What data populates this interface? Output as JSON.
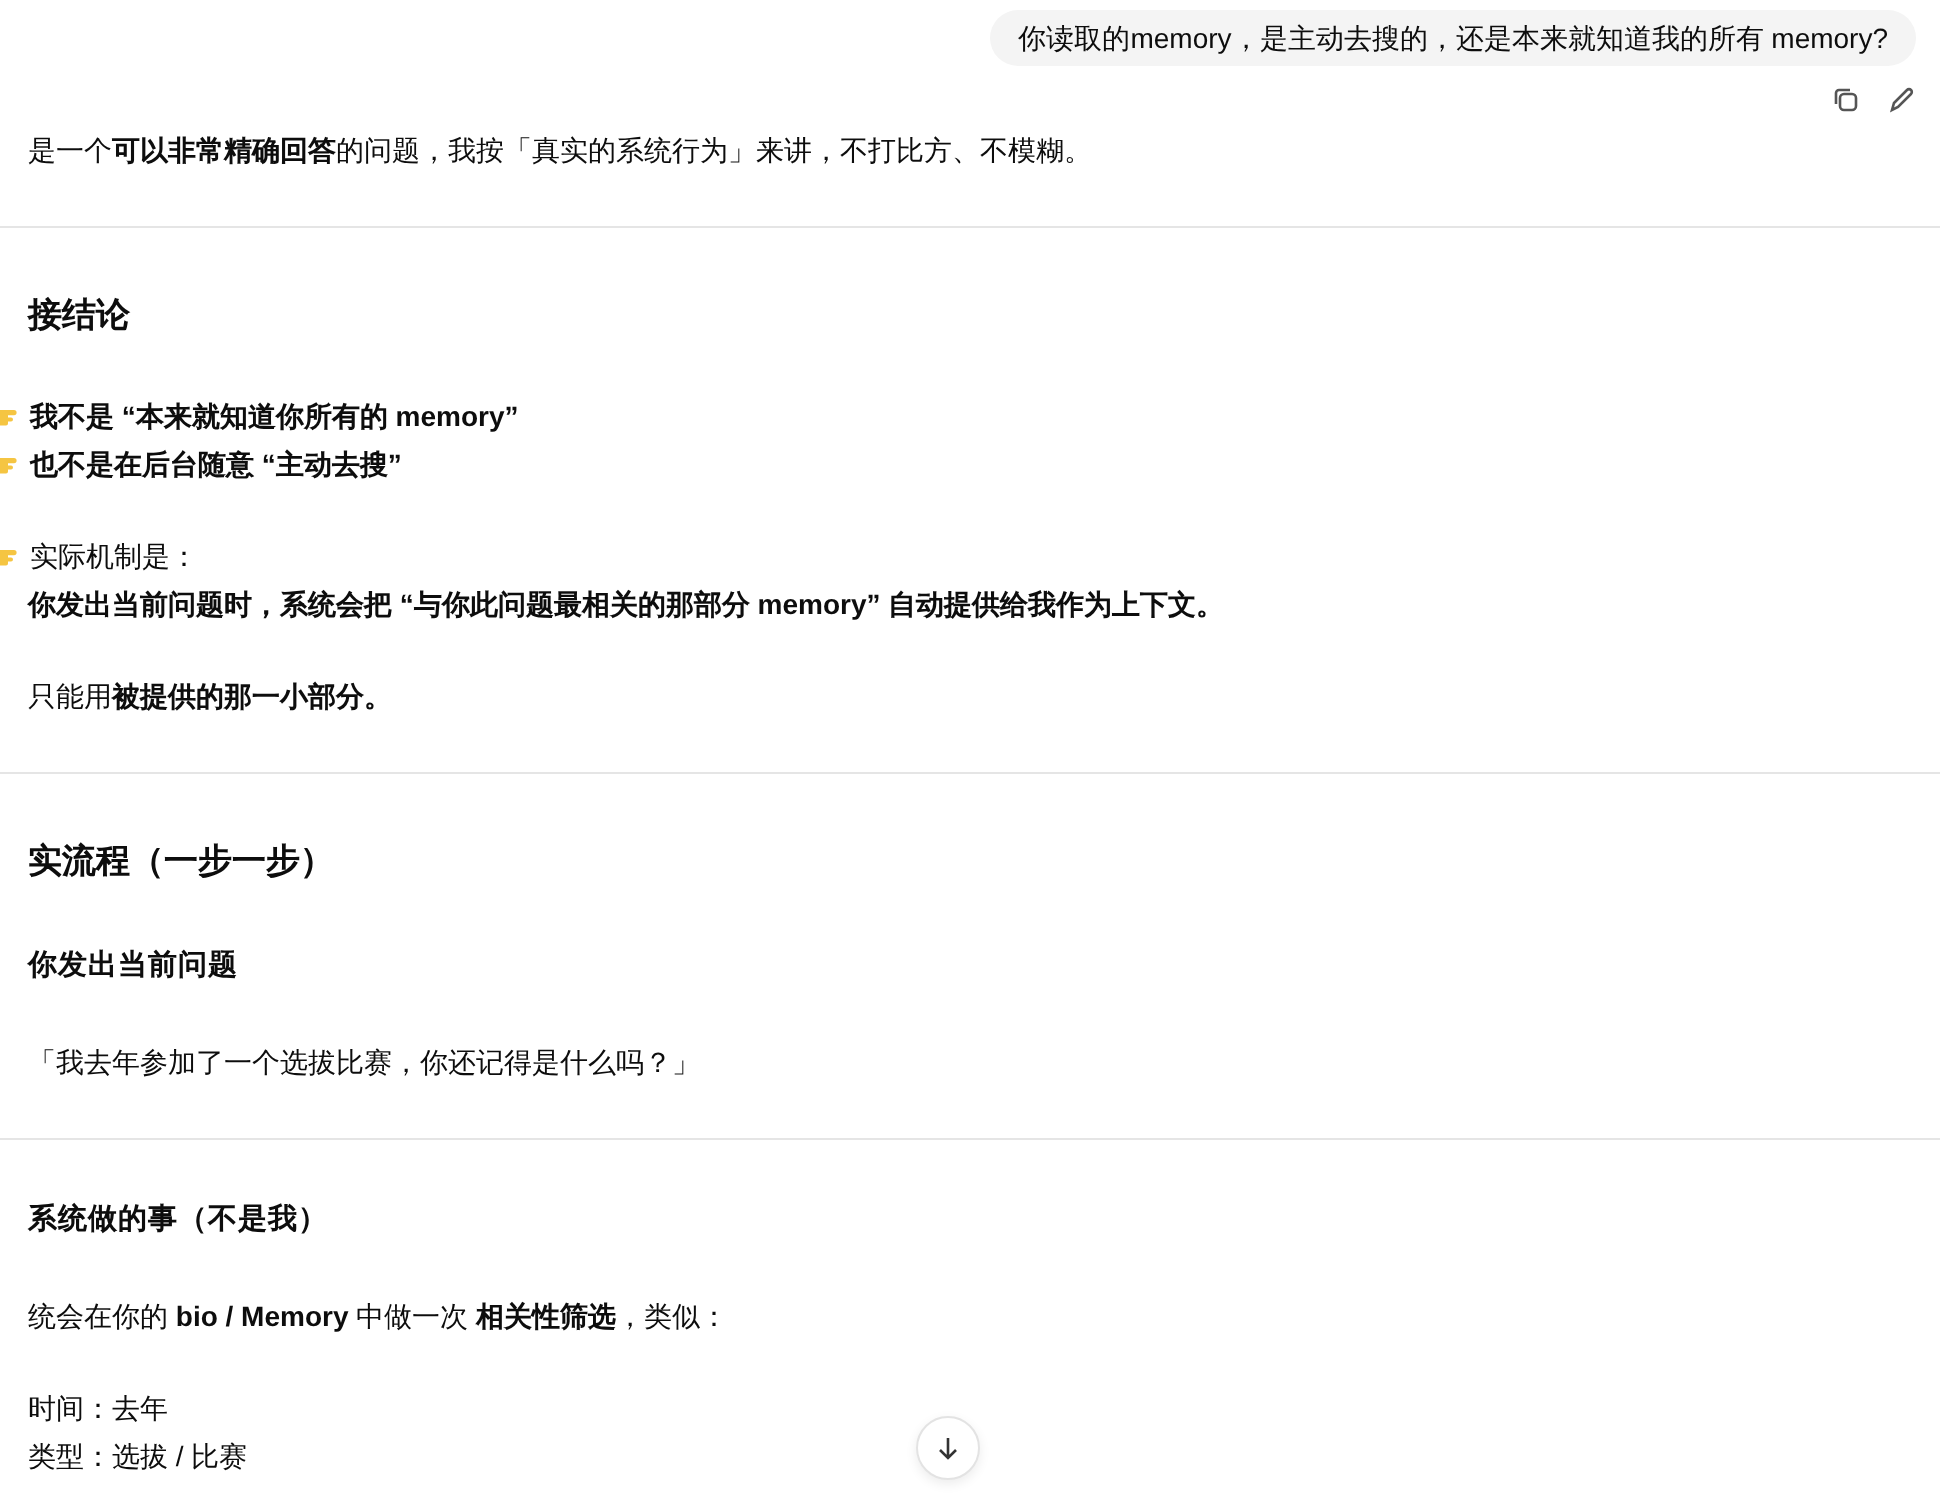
{
  "user_message": {
    "text": "你读取的memory，是主动去搜的，还是本来就知道我的所有 memory?"
  },
  "answer": [
    {
      "kind": "lines",
      "items": [
        {
          "kind": "plain",
          "bold": false,
          "text": "是一个**可以非常精确回答**的问题，我按「真实的系统行为」来讲，不打比方、不模糊。"
        }
      ]
    },
    {
      "kind": "divider"
    },
    {
      "kind": "heading",
      "text": "接结论"
    },
    {
      "kind": "lines",
      "items": [
        {
          "kind": "pointer",
          "bold": true,
          "text": "我不是 “本来就知道你所有的 memory”"
        },
        {
          "kind": "pointer",
          "bold": true,
          "text": "也不是在后台随意 “主动去搜”"
        }
      ]
    },
    {
      "kind": "lines",
      "items": [
        {
          "kind": "pointer",
          "bold": false,
          "text": "实际机制是："
        },
        {
          "kind": "plain",
          "bold": true,
          "text": "你发出当前问题时，系统会把 “与你此问题最相关的那部分 memory” 自动提供给我作为上下文。"
        }
      ]
    },
    {
      "kind": "lines",
      "items": [
        {
          "kind": "plain",
          "bold": false,
          "text": "只能用**被提供的那一小部分。**"
        }
      ]
    },
    {
      "kind": "divider"
    },
    {
      "kind": "heading",
      "text": "实流程（一步一步）"
    },
    {
      "kind": "subheading",
      "text": "你发出当前问题"
    },
    {
      "kind": "lines",
      "items": [
        {
          "kind": "plain",
          "bold": false,
          "text": "「我去年参加了一个选拔比赛，你还记得是什么吗？」"
        }
      ]
    },
    {
      "kind": "divider"
    },
    {
      "kind": "subheading",
      "text": "系统做的事（不是我）"
    },
    {
      "kind": "lines",
      "items": [
        {
          "kind": "plain",
          "bold": false,
          "text": "统会在你的 **bio / Memory** 中做一次 **相关性筛选**，类似："
        }
      ]
    },
    {
      "kind": "lines",
      "items": [
        {
          "kind": "plain",
          "bold": false,
          "text": "时间：去年"
        },
        {
          "kind": "plain",
          "bold": false,
          "text": "类型：选拔 / 比赛"
        }
      ]
    }
  ]
}
